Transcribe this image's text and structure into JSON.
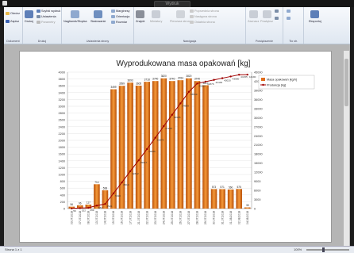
{
  "window": {
    "title": "Wydruk"
  },
  "ribbon": {
    "groups": {
      "dokument": {
        "label": "Dokument",
        "open": "Otwórz",
        "save": "Zapisz"
      },
      "druk": {
        "label": "Drukuj",
        "print": "Drukuj",
        "quick_print": "Szybki wydruk",
        "settings": "Ustawienia",
        "params": "Parametry"
      },
      "page_setup": {
        "label": "Ustawienia strony",
        "header_footer": "Nagłówek/Stopka",
        "scaling": "Skalowanie",
        "margins": "Marginesy",
        "orientation": "Orientacja",
        "size": "Rozmiar"
      },
      "navigation": {
        "label": "Nawigacja",
        "find": "Znajdź",
        "thumbnails": "Miniatury",
        "prev": "Poprzednia strona",
        "next": "Następna strona",
        "first": "Pierwsza strona",
        "last": "Ostatnia strona"
      },
      "view": {
        "label": "Powiększenie",
        "select": "Zaznacz",
        "zoom": "Powiększ",
        "zoom_in": "Powiększ",
        "zoom_out": "Pomniejsz"
      },
      "background": {
        "label": "Tło str."
      },
      "export": {
        "label": "",
        "export": "Eksportuj"
      }
    }
  },
  "chart_data": {
    "type": "bar",
    "title": "Wyprodukowana masa opakowań [kg]",
    "categories": [
      "03.07.2018",
      "07.07.2018",
      "08.07.2018",
      "13.07.2018",
      "14.07.2018",
      "15.07.2018",
      "16.07.2018",
      "17.07.2018",
      "21.07.2018",
      "22.07.2018",
      "23.07.2018",
      "24.07.2018",
      "25.07.2018",
      "26.07.2018",
      "27.07.2018",
      "28.07.2018",
      "29.07.2018",
      "30.07.2018",
      "31.07.2018",
      "01.08.2018",
      "02.08.2018",
      "04.08.2018"
    ],
    "series": [
      {
        "name": "Masa opakowań [kg/h]",
        "kind": "bar",
        "axis": "left",
        "color": "#e06c1a",
        "values": [
          56,
          96,
          117,
          714,
          538,
          3499,
          3599,
          3693,
          3605,
          3718,
          3740,
          3820,
          3740,
          3764,
          3820,
          3740,
          3617,
          573,
          571,
          560,
          575,
          35
        ]
      },
      {
        "name": "Produkcja [kg]",
        "kind": "line",
        "axis": "right",
        "color": "#a00000",
        "values": [
          56,
          152,
          269,
          983,
          1521,
          5020,
          8619,
          12312,
          15917,
          19635,
          23375,
          27195,
          30935,
          34699,
          38519,
          41259,
          41876,
          42449,
          43020,
          43580,
          44155,
          44190
        ],
        "labels": [
          "56",
          "152",
          "269",
          "983",
          "1521",
          "5020",
          "8619",
          "12312",
          "15917",
          "19635",
          "23375",
          "27195",
          "30935",
          "34699",
          "38519",
          "41259",
          "41876",
          "42449",
          "43020",
          "43580",
          "44155",
          "44190"
        ]
      }
    ],
    "bar_labels": [
      "56",
      "96",
      "117",
      "714",
      "538",
      "3499",
      "3599",
      "3693",
      "3605",
      "3718",
      "3740",
      "3820",
      "3740",
      "3764",
      "3820",
      "3740",
      "3617",
      "573",
      "571",
      "560",
      "575",
      "35"
    ],
    "ylim_left": [
      0,
      4000
    ],
    "yticks_left": [
      0,
      200,
      400,
      600,
      800,
      1000,
      1200,
      1400,
      1600,
      1800,
      2000,
      2200,
      2400,
      2600,
      2800,
      3000,
      3200,
      3400,
      3600,
      3800,
      4000
    ],
    "ylim_right": [
      0,
      45000
    ],
    "yticks_right": [
      0,
      3000,
      6000,
      9000,
      12000,
      15000,
      18000,
      21000,
      24000,
      27000,
      30000,
      33000,
      36000,
      39000,
      42000,
      45000
    ],
    "grid": true,
    "legend": "top-right"
  },
  "status": {
    "page": "Strona 1 z 1",
    "zoom": "100%"
  }
}
